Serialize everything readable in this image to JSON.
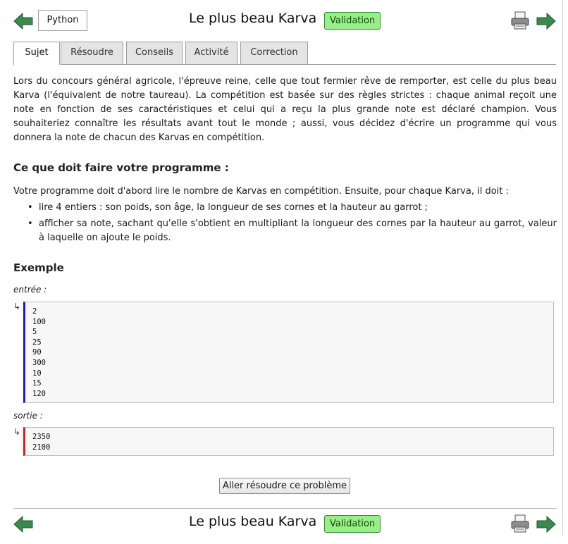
{
  "header": {
    "lang_button": "Python",
    "title": "Le plus beau Karva",
    "badge": "Validation"
  },
  "tabs": [
    {
      "label": "Sujet",
      "active": true
    },
    {
      "label": "Résoudre",
      "active": false
    },
    {
      "label": "Conseils",
      "active": false
    },
    {
      "label": "Activité",
      "active": false
    },
    {
      "label": "Correction",
      "active": false
    }
  ],
  "subject": {
    "intro_paragraph": "Lors du concours général agricole, l'épreuve reine, celle que tout fermier rêve de remporter, est celle du plus beau Karva (l'équivalent de notre taureau). La compétition est basée sur des règles strictes : chaque animal reçoit une note en fonction de ses caractéristiques et celui qui a reçu la plus grande note est déclaré champion. Vous souhaiteriez connaître les résultats avant tout le monde ; aussi, vous décidez d'écrire un programme qui vous donnera la note de chacun des Karvas en compétition.",
    "section_title": "Ce que doit faire votre programme :",
    "section_intro": "Votre programme doit d'abord lire le nombre de Karvas en compétition. Ensuite, pour chaque Karva, il doit :",
    "bullets": [
      "lire 4 entiers : son poids, son âge, la longueur de ses cornes et la hauteur au garrot ;",
      "afficher sa note, sachant qu'elle s'obtient en multipliant la longueur des cornes par la hauteur au garrot, valeur à laquelle on ajoute le poids."
    ]
  },
  "example": {
    "title": "Exemple",
    "input_label": "entrée :",
    "input_lines": [
      "2",
      "100",
      "5",
      "25",
      "90",
      "300",
      "10",
      "15",
      "120"
    ],
    "output_label": "sortie :",
    "output_lines": [
      "2350",
      "2100"
    ],
    "return_symbol": "↳"
  },
  "solve_button": "Aller résoudre ce problème",
  "footer": {
    "title": "Le plus beau Karva",
    "badge": "Validation"
  },
  "colors": {
    "arrow": "#3a8a4e",
    "badge_bg": "#99ee88",
    "input_border": "#1a1ad0",
    "output_border": "#e01a1a"
  }
}
